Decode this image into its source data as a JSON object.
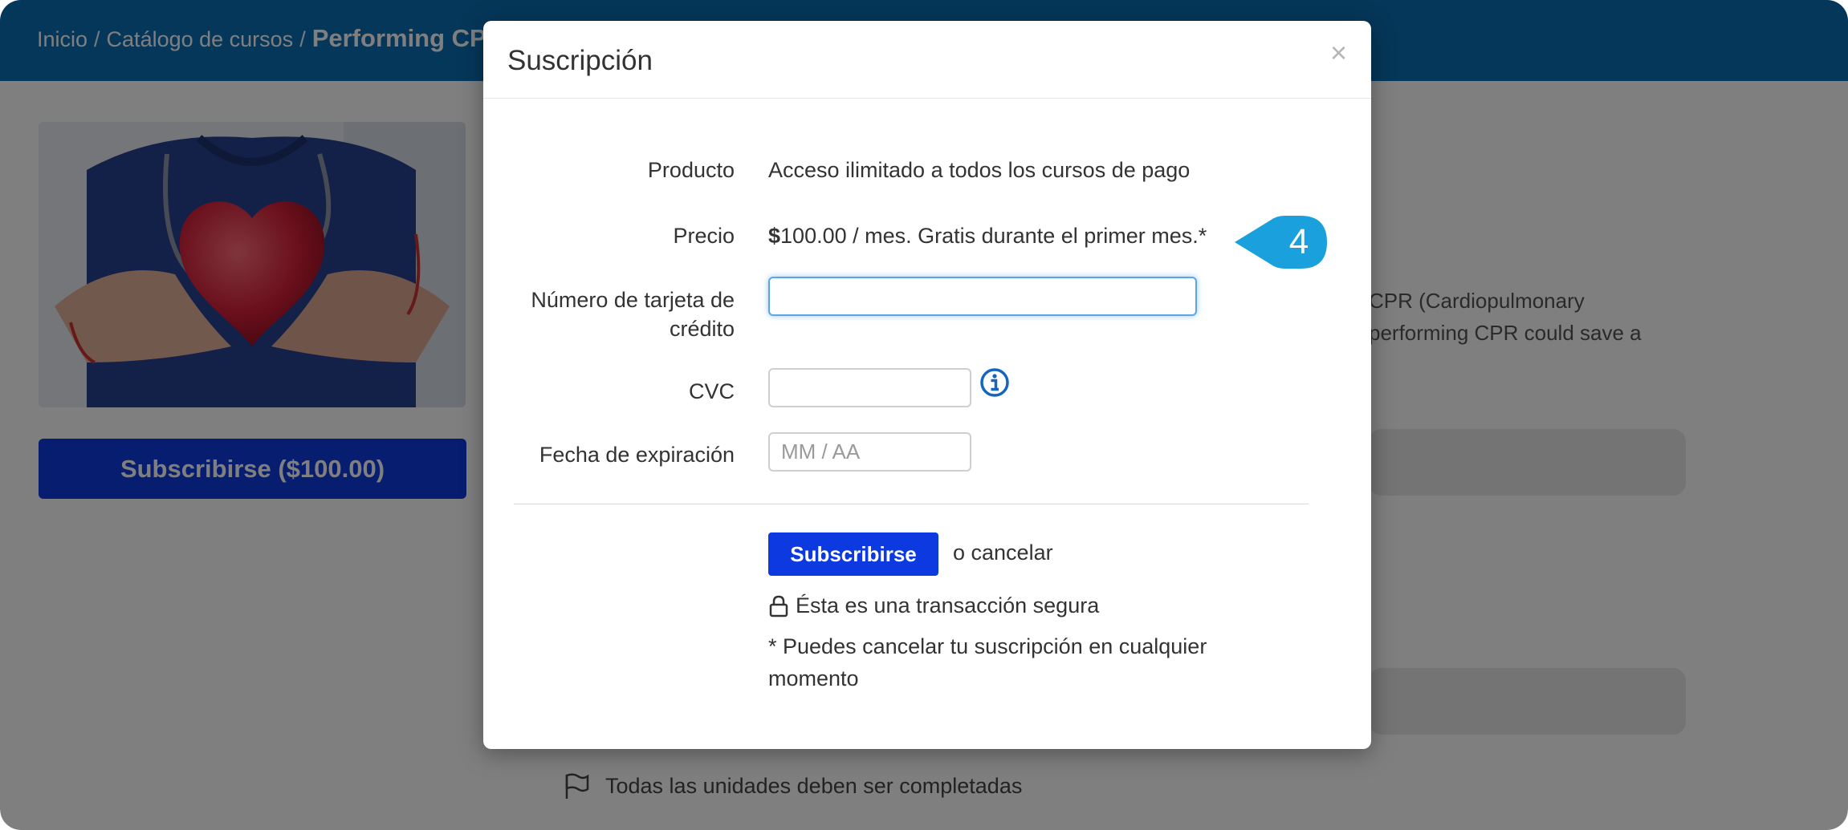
{
  "breadcrumb": {
    "home": "Inicio",
    "separator": "/",
    "catalog": "Catálogo de cursos",
    "current": "Performing CPR"
  },
  "course": {
    "image_icon": "heart-in-hands-image",
    "subscribe_label": "Subscribirse ($100.00)",
    "description_line1": "CPR (Cardiopulmonary",
    "description_line2": "performing CPR could save a",
    "units_note": "Todas las unidades deben ser completadas"
  },
  "modal": {
    "title": "Suscripción",
    "close_label": "×",
    "product_label": "Producto",
    "product_value": "Acceso ilimitado a todos los cursos de pago",
    "price_label": "Precio",
    "price_currency": "$",
    "price_value": "100.00 / mes. Gratis durante el primer mes.*",
    "card_label_line1": "Número de tarjeta de",
    "card_label_line2": "crédito",
    "card_value": "",
    "cvc_label": "CVC",
    "cvc_value": "",
    "expiry_label": "Fecha de expiración",
    "expiry_placeholder": "MM / AA",
    "subscribe_button": "Subscribirse",
    "cancel_text": "o cancelar",
    "secure_text": "Ésta es una transacción segura",
    "note_text": "* Puedes cancelar tu suscripción en cualquier momento"
  },
  "callout": {
    "step": "4"
  },
  "colors": {
    "header": "#0a6fb4",
    "primary_button": "#0d3ae0",
    "callout": "#1aa1dd",
    "info_icon": "#1565c0"
  }
}
